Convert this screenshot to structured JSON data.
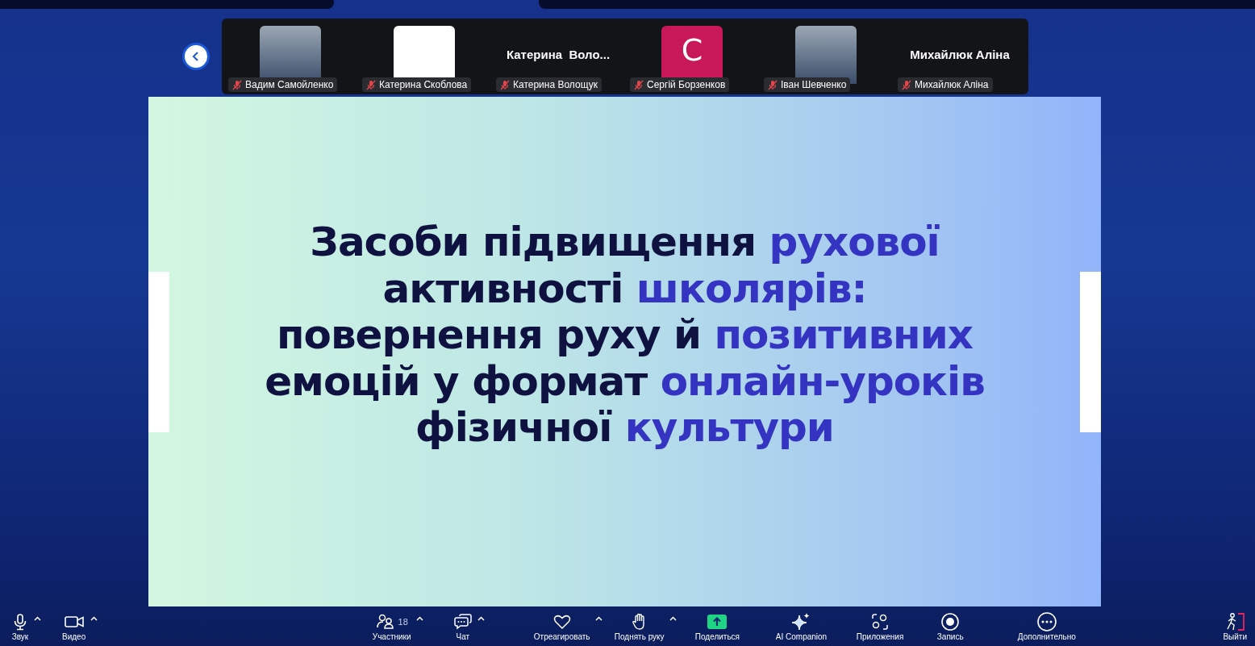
{
  "participants": [
    {
      "name": "Вадим Самойленко",
      "kind": "photo",
      "muted": true
    },
    {
      "name": "Катерина Скоблова",
      "kind": "blank",
      "muted": true
    },
    {
      "name": "Катерина Волощук",
      "kind": "name",
      "display": "Катерина  Воло...",
      "muted": true
    },
    {
      "name": "Сергій Борзенков",
      "kind": "initial",
      "display": "С",
      "color": "#c8185a",
      "muted": true
    },
    {
      "name": "Іван Шевченко",
      "kind": "photo",
      "muted": true
    },
    {
      "name": "Михайлюк Аліна",
      "kind": "name",
      "display": "Михайлюк Аліна",
      "muted": true
    }
  ],
  "slide": {
    "title_lines": [
      [
        {
          "text": "Засоби підвищення ",
          "accent": false
        },
        {
          "text": "рухової",
          "accent": true
        }
      ],
      [
        {
          "text": "активності ",
          "accent": false
        },
        {
          "text": "школярів:",
          "accent": true
        }
      ],
      [
        {
          "text": "повернення руху й ",
          "accent": false
        },
        {
          "text": "позитивних",
          "accent": true
        }
      ],
      [
        {
          "text": "емоцій у формат ",
          "accent": false
        },
        {
          "text": "онлайн-уроків",
          "accent": true
        }
      ],
      [
        {
          "text": "фізичної ",
          "accent": false
        },
        {
          "text": "культури",
          "accent": true
        }
      ]
    ]
  },
  "toolbar": {
    "left": [
      {
        "kind": "mic",
        "label": "Звук",
        "caret": true
      },
      {
        "kind": "video",
        "label": "Видео",
        "caret": true
      }
    ],
    "center": [
      {
        "kind": "participants",
        "label": "Участники",
        "count": "18",
        "caret": true
      },
      {
        "kind": "chat",
        "label": "Чат",
        "caret": true
      },
      {
        "kind": "heart",
        "label": "Отреагировать",
        "caret": true
      },
      {
        "kind": "hand",
        "label": "Поднять руку",
        "caret": true
      },
      {
        "kind": "share",
        "label": "Поделиться",
        "caret": false
      },
      {
        "kind": "sparkle",
        "label": "AI Companion",
        "caret": false
      },
      {
        "kind": "apps",
        "label": "Приложения",
        "caret": false
      },
      {
        "kind": "record",
        "label": "Запись",
        "caret": false
      },
      {
        "kind": "more",
        "label": "Дополнительно",
        "caret": false
      }
    ],
    "right": [
      {
        "kind": "exit",
        "label": "Выйти",
        "caret": false
      }
    ]
  }
}
